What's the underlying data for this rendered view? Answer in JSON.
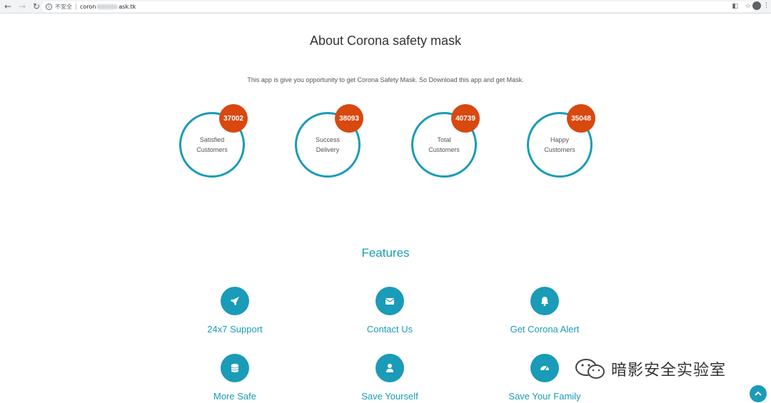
{
  "browser": {
    "security_label": "不安全",
    "url_prefix": "coron",
    "url_suffix": "ask.tk"
  },
  "about": {
    "title": "About Corona safety mask",
    "lead": "This app is give you opportunity to get Corona Safety Mask. So Download this app and get Mask."
  },
  "stats": [
    {
      "value": "37002",
      "label_line1": "Satisfied",
      "label_line2": "Customers"
    },
    {
      "value": "38093",
      "label_line1": "Success",
      "label_line2": "Delivery"
    },
    {
      "value": "40739",
      "label_line1": "Total",
      "label_line2": "Customers"
    },
    {
      "value": "35048",
      "label_line1": "Happy",
      "label_line2": "Customers"
    }
  ],
  "features": {
    "title": "Features",
    "items": [
      {
        "label": "24x7 Support",
        "icon": "rocket-icon"
      },
      {
        "label": "Contact Us",
        "icon": "envelope-icon"
      },
      {
        "label": "Get Corona Alert",
        "icon": "bell-icon"
      },
      {
        "label": "More Safe",
        "icon": "database-icon"
      },
      {
        "label": "Save Yourself",
        "icon": "user-icon"
      },
      {
        "label": "Save Your Family",
        "icon": "dashboard-icon"
      }
    ]
  },
  "watermark": {
    "text": "暗影安全实验室",
    "icon": "wechat-icon"
  },
  "colors": {
    "accent": "#1a9bb8",
    "badge": "#d9480f"
  }
}
